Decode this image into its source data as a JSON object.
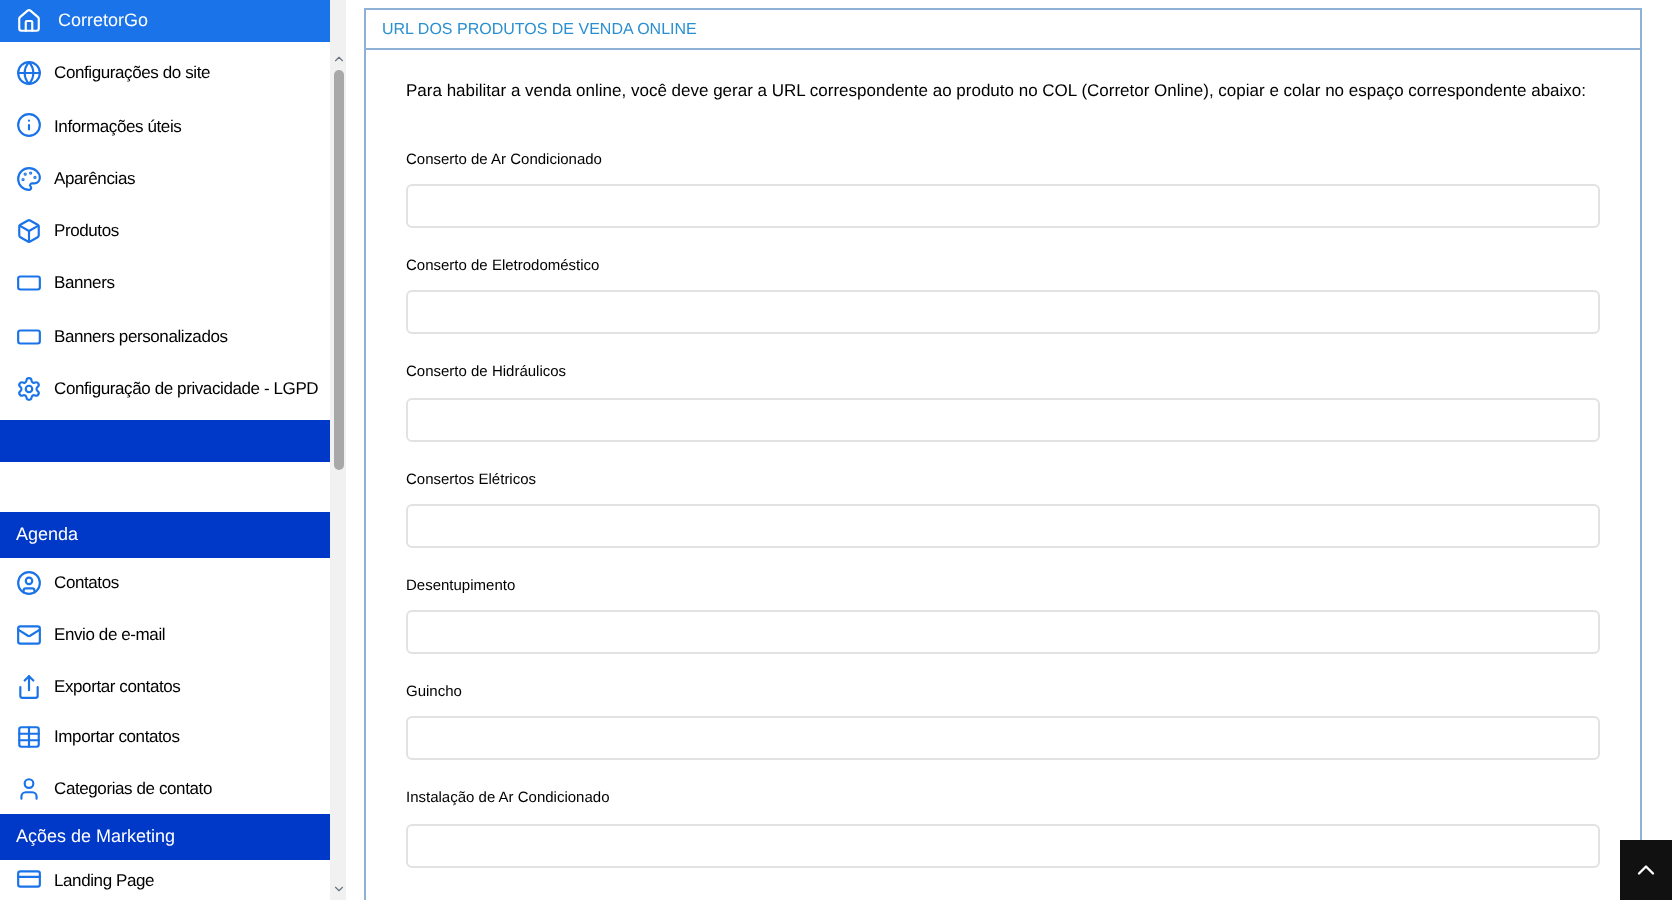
{
  "sidebar": {
    "header": "CorretorGo",
    "items": [
      {
        "label": "Configurações do site"
      },
      {
        "label": "Informações úteis"
      },
      {
        "label": "Aparências"
      },
      {
        "label": "Produtos"
      },
      {
        "label": "Banners"
      },
      {
        "label": "Banners personalizados"
      },
      {
        "label": "Configuração de privacidade - LGPD"
      }
    ],
    "sections": [
      {
        "title": "Agenda",
        "items": [
          {
            "label": "Contatos"
          },
          {
            "label": "Envio de e-mail"
          },
          {
            "label": "Exportar contatos"
          },
          {
            "label": "Importar contatos"
          },
          {
            "label": "Categorias de contato"
          }
        ]
      },
      {
        "title": "Ações de Marketing",
        "items": [
          {
            "label": "Landing Page"
          }
        ]
      }
    ]
  },
  "panel": {
    "title": "URL DOS PRODUTOS DE VENDA ONLINE",
    "intro": "Para habilitar a venda online, você deve gerar a URL correspondente ao produto no COL (Corretor Online), copiar e colar no espaço correspondente abaixo:",
    "fields": [
      {
        "label": "Conserto de Ar Condicionado"
      },
      {
        "label": "Conserto de Eletrodoméstico"
      },
      {
        "label": "Conserto de Hidráulicos"
      },
      {
        "label": "Consertos Elétricos"
      },
      {
        "label": "Desentupimento"
      },
      {
        "label": "Guincho"
      },
      {
        "label": "Instalação de Ar Condicionado"
      }
    ]
  }
}
